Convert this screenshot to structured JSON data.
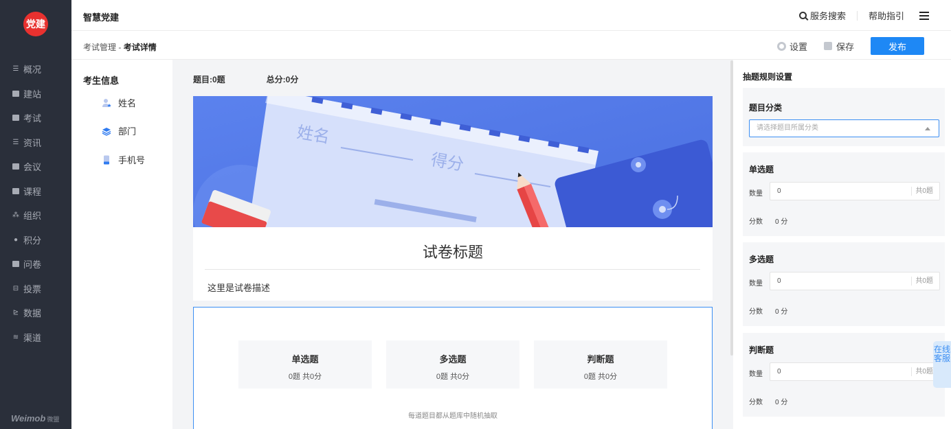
{
  "sidebar": {
    "logo": "党建",
    "items": [
      {
        "label": "概况",
        "icon": "overview-icon"
      },
      {
        "label": "建站",
        "icon": "site-icon"
      },
      {
        "label": "考试",
        "icon": "exam-icon"
      },
      {
        "label": "资讯",
        "icon": "news-icon"
      },
      {
        "label": "会议",
        "icon": "meeting-icon"
      },
      {
        "label": "课程",
        "icon": "course-icon"
      },
      {
        "label": "组织",
        "icon": "org-icon"
      },
      {
        "label": "积分",
        "icon": "points-icon"
      },
      {
        "label": "问卷",
        "icon": "survey-icon"
      },
      {
        "label": "投票",
        "icon": "vote-icon"
      },
      {
        "label": "数据",
        "icon": "data-icon"
      },
      {
        "label": "渠道",
        "icon": "channel-icon"
      }
    ],
    "brand": "Weimob",
    "brand_sub": "微盟"
  },
  "header": {
    "title": "智慧党建",
    "search_label": "服务搜索",
    "help_label": "帮助指引"
  },
  "subheader": {
    "crumb_parent": "考试管理",
    "crumb_sep": " - ",
    "crumb_current": "考试详情",
    "settings_label": "设置",
    "save_label": "保存",
    "publish_label": "发布"
  },
  "candidate": {
    "title": "考生信息",
    "fields": [
      "姓名",
      "部门",
      "手机号"
    ]
  },
  "main": {
    "question_count": "题目:0题",
    "total_score": "总分:0分",
    "banner_name": "姓名",
    "banner_score": "得分",
    "paper_title": "试卷标题",
    "paper_desc": "这里是试卷描述",
    "types": [
      {
        "name": "单选题",
        "count": "0题  共0分"
      },
      {
        "name": "多选题",
        "count": "0题  共0分"
      },
      {
        "name": "判断题",
        "count": "0题  共0分"
      }
    ],
    "note": "每道题目都从题库中随机抽取"
  },
  "rules": {
    "title": "抽题规则设置",
    "category_title": "题目分类",
    "category_placeholder": "请选择题目所属分类",
    "qty_label": "数量",
    "score_label": "分数",
    "sections": [
      {
        "title": "单选题",
        "qty": "0",
        "unit": "共0题",
        "score": "0 分"
      },
      {
        "title": "多选题",
        "qty": "0",
        "unit": "共0题",
        "score": "0 分"
      },
      {
        "title": "判断题",
        "qty": "0",
        "unit": "共0题",
        "score": "0 分"
      }
    ]
  },
  "kefu": "在线客服"
}
